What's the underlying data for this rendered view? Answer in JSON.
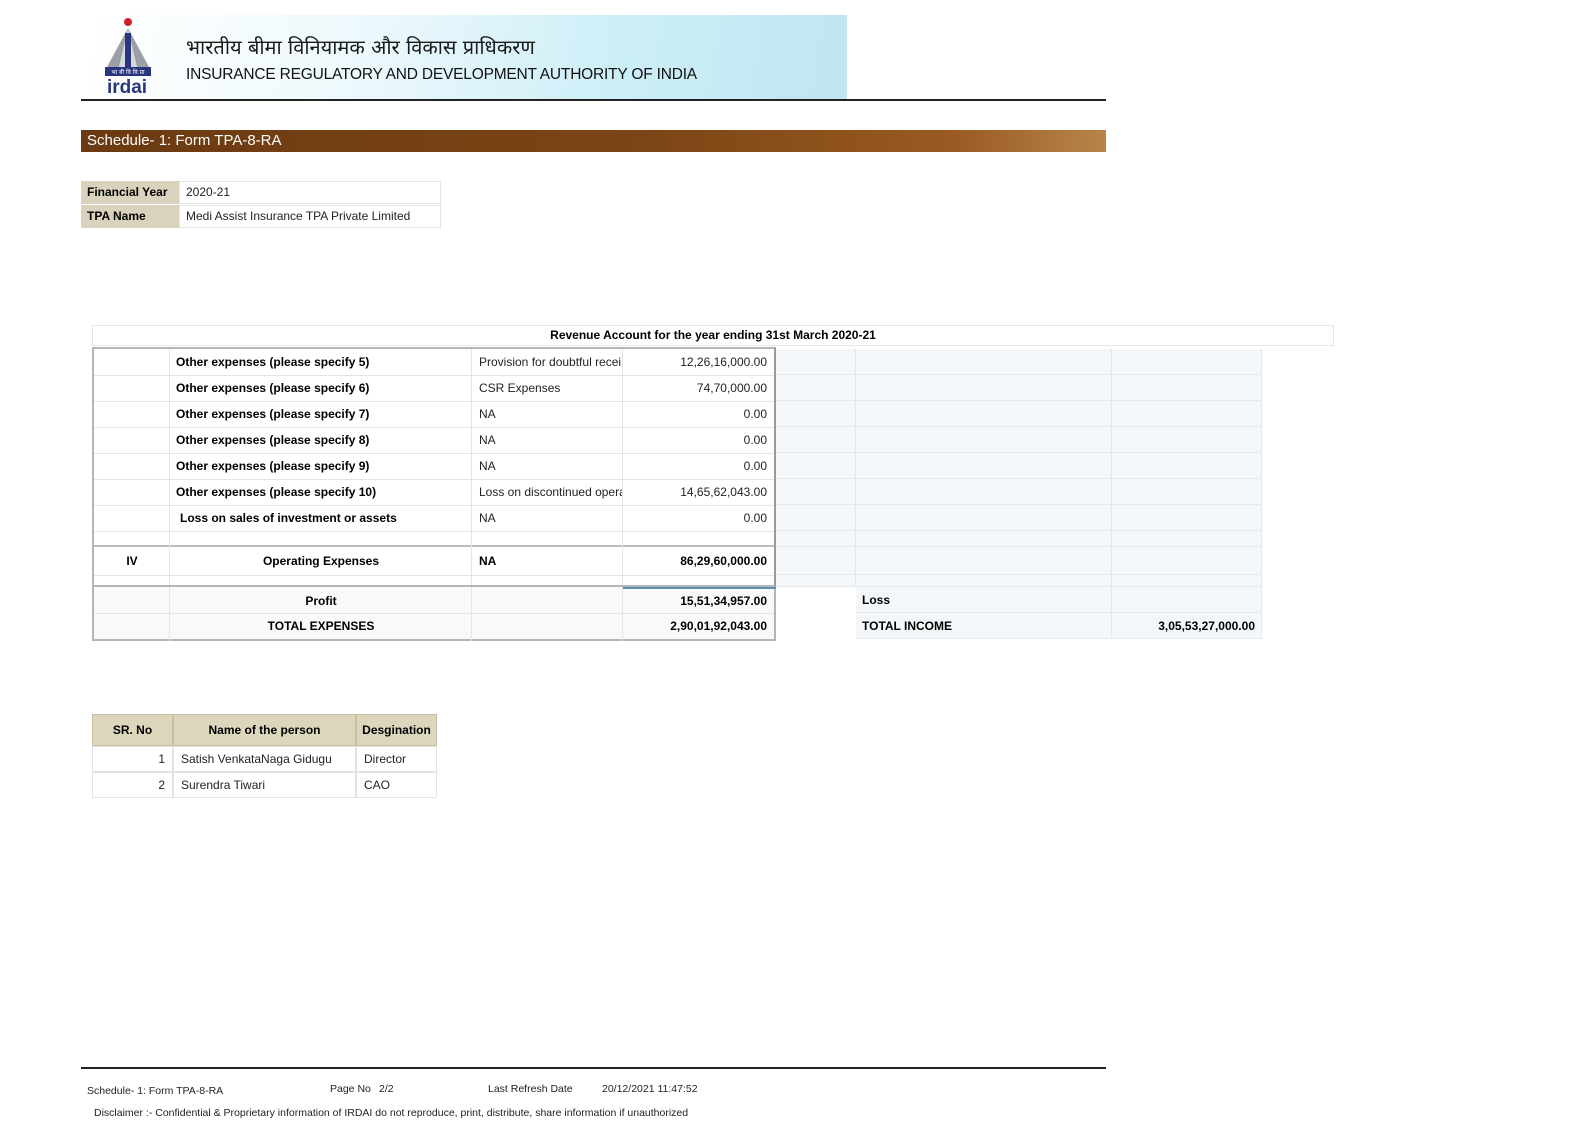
{
  "header": {
    "logo_text": "irdai",
    "logo_hindi_strip": "भा बी वि वि प्रा",
    "title_hindi": "भारतीय बीमा विनियामक और विकास प्राधिकरण",
    "title_english": "INSURANCE REGULATORY AND DEVELOPMENT AUTHORITY OF INDIA"
  },
  "schedule_title": "Schedule- 1: Form TPA-8-RA",
  "info": {
    "financial_year_label": "Financial Year",
    "financial_year_value": "2020-21",
    "tpa_name_label": "TPA Name",
    "tpa_name_value": "Medi Assist Insurance TPA Private Limited"
  },
  "revenue": {
    "title": "Revenue Account for the year ending 31st March 2020-21",
    "rows": [
      {
        "sr": "",
        "label": "Other expenses (please specify 5)",
        "detail": "Provision for doubtful recei",
        "amount": "12,26,16,000.00"
      },
      {
        "sr": "",
        "label": "Other expenses (please specify 6)",
        "detail": "CSR Expenses",
        "amount": "74,70,000.00"
      },
      {
        "sr": "",
        "label": "Other expenses (please specify 7)",
        "detail": "NA",
        "amount": "0.00"
      },
      {
        "sr": "",
        "label": "Other expenses (please specify 8)",
        "detail": "NA",
        "amount": "0.00"
      },
      {
        "sr": "",
        "label": "Other expenses (please specify 9)",
        "detail": "NA",
        "amount": "0.00"
      },
      {
        "sr": "",
        "label": "Other expenses (please specify 10)",
        "detail": "Loss on discontinued opera",
        "amount": "14,65,62,043.00"
      },
      {
        "sr": "",
        "label": "Loss on sales of investment or assets",
        "detail": "NA",
        "amount": "0.00"
      }
    ],
    "operating": {
      "sr": "IV",
      "label": "Operating Expenses",
      "detail": "NA",
      "amount": "86,29,60,000.00"
    },
    "profit": {
      "label": "Profit",
      "amount": "15,51,34,957.00"
    },
    "total_expenses": {
      "label": "TOTAL EXPENSES",
      "amount": "2,90,01,92,043.00"
    },
    "loss": {
      "label": "Loss",
      "amount": ""
    },
    "total_income": {
      "label": "TOTAL INCOME",
      "amount": "3,05,53,27,000.00"
    }
  },
  "persons": {
    "headers": [
      "SR. No",
      "Name of the person",
      "Desgination"
    ],
    "rows": [
      {
        "sr": "1",
        "name": "Satish VenkataNaga Gidugu",
        "designation": "Director"
      },
      {
        "sr": "2",
        "name": "Surendra Tiwari",
        "designation": "CAO"
      }
    ]
  },
  "footer": {
    "form": "Schedule- 1: Form TPA-8-RA",
    "page_label": "Page No",
    "page_value": "2/2",
    "refresh_label": "Last Refresh Date",
    "refresh_value": "20/12/2021 11:47:52",
    "disclaimer": "Disclaimer :- Confidential & Proprietary information of IRDAI do not reproduce, print, distribute, share information if unauthorized"
  },
  "colors": {
    "schedule_bar": "#7c4515",
    "label_bg": "#d9d3bd",
    "panel_bg": "#f4f7f9",
    "logo_red": "#d0202a",
    "logo_blue": "#2a3580"
  }
}
